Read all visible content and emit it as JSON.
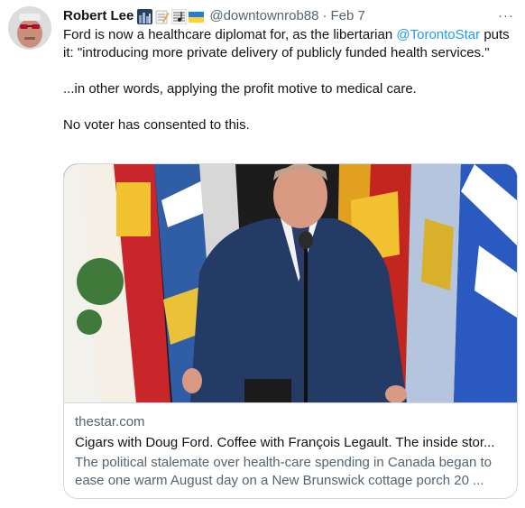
{
  "tweet": {
    "author_name": "Robert Lee",
    "handle": "@downtownrob88",
    "separator": "·",
    "date": "Feb 7",
    "more_label": "···",
    "emojis": [
      "city-at-night-icon",
      "memo-icon",
      "musical-score-icon",
      "ukraine-flag-icon"
    ],
    "line1_before": "Ford is now a healthcare diplomat for, as the libertarian ",
    "mention": "@TorontoStar",
    "line1_after": " puts it: \"introducing more private delivery of publicly funded health services.\"",
    "paragraph2": "...in other words, applying the profit motive to medical care.",
    "paragraph3": "No voter has consented to this."
  },
  "card": {
    "domain": "thestar.com",
    "title": "Cigars with Doug Ford. Coffee with François Legault. The inside stor...",
    "description": "The political stalemate over health-care spending in Canada began to ease one warm August day on a New Brunswick cottage porch 20 ..."
  },
  "colors": {
    "text": "#0f1419",
    "muted": "#536471",
    "link": "#1d9bf0",
    "border": "#cfd9de"
  }
}
